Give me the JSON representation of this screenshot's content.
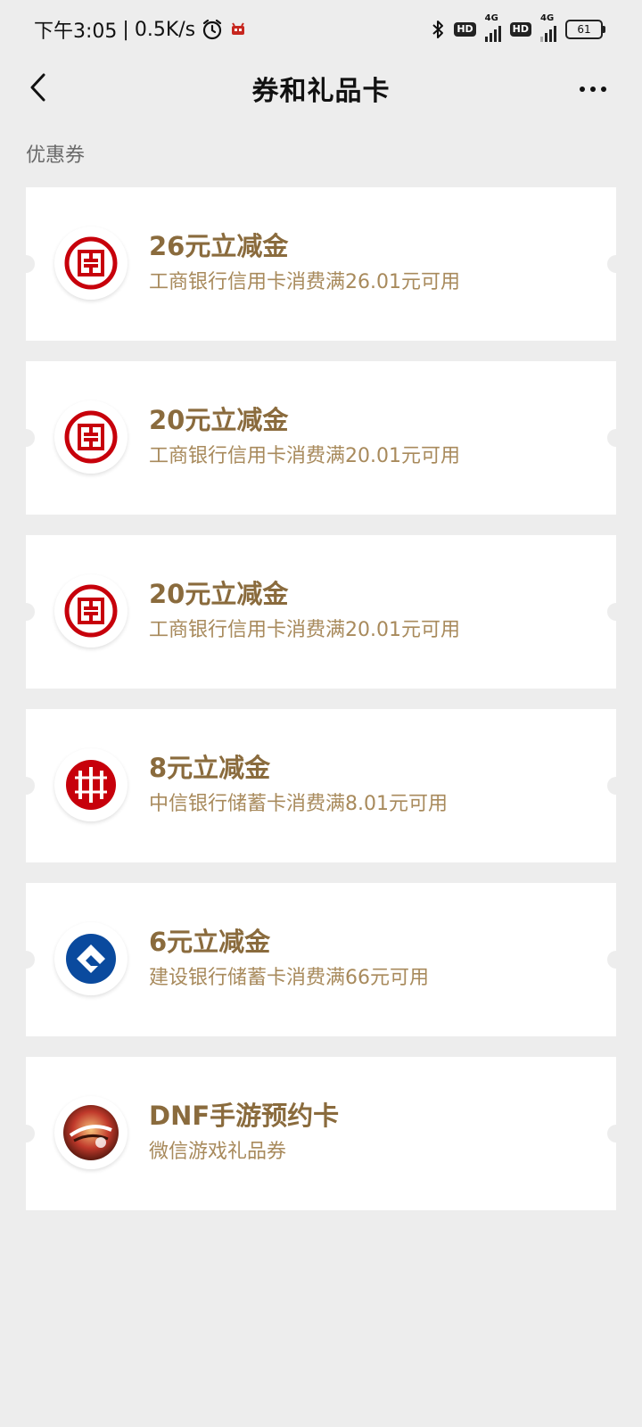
{
  "status_bar": {
    "time": "下午3:05",
    "separator": "|",
    "speed": "0.5K/s",
    "net_tag_1": "4G",
    "net_tag_2": "4G",
    "hd_1": "HD",
    "hd_2": "HD",
    "battery": "61",
    "icons": [
      "alarm-icon",
      "app-notification-icon",
      "bluetooth-icon",
      "signal-icon",
      "battery-icon"
    ]
  },
  "nav": {
    "title": "券和礼品卡",
    "back_icon": "chevron-left-icon",
    "more_icon": "more-icon"
  },
  "section": {
    "label": "优惠券"
  },
  "cards": [
    {
      "title": "26元立减金",
      "subtitle": "工商银行信用卡消费满26.01元可用",
      "logo": "icbc-logo"
    },
    {
      "title": "20元立减金",
      "subtitle": "工商银行信用卡消费满20.01元可用",
      "logo": "icbc-logo"
    },
    {
      "title": "20元立减金",
      "subtitle": "工商银行信用卡消费满20.01元可用",
      "logo": "icbc-logo"
    },
    {
      "title": "8元立减金",
      "subtitle": "中信银行储蓄卡消费满8.01元可用",
      "logo": "citic-logo"
    },
    {
      "title": "6元立减金",
      "subtitle": "建设银行储蓄卡消费满66元可用",
      "logo": "ccb-logo"
    },
    {
      "title": "DNF手游预约卡",
      "subtitle": "微信游戏礼品券",
      "logo": "dnf-logo"
    }
  ],
  "colors": {
    "background": "#ededed",
    "card_title": "#8a6b3d",
    "card_subtitle": "#a88a5c",
    "icbc_red": "#c7000b",
    "ccb_blue": "#0a4a9e"
  }
}
